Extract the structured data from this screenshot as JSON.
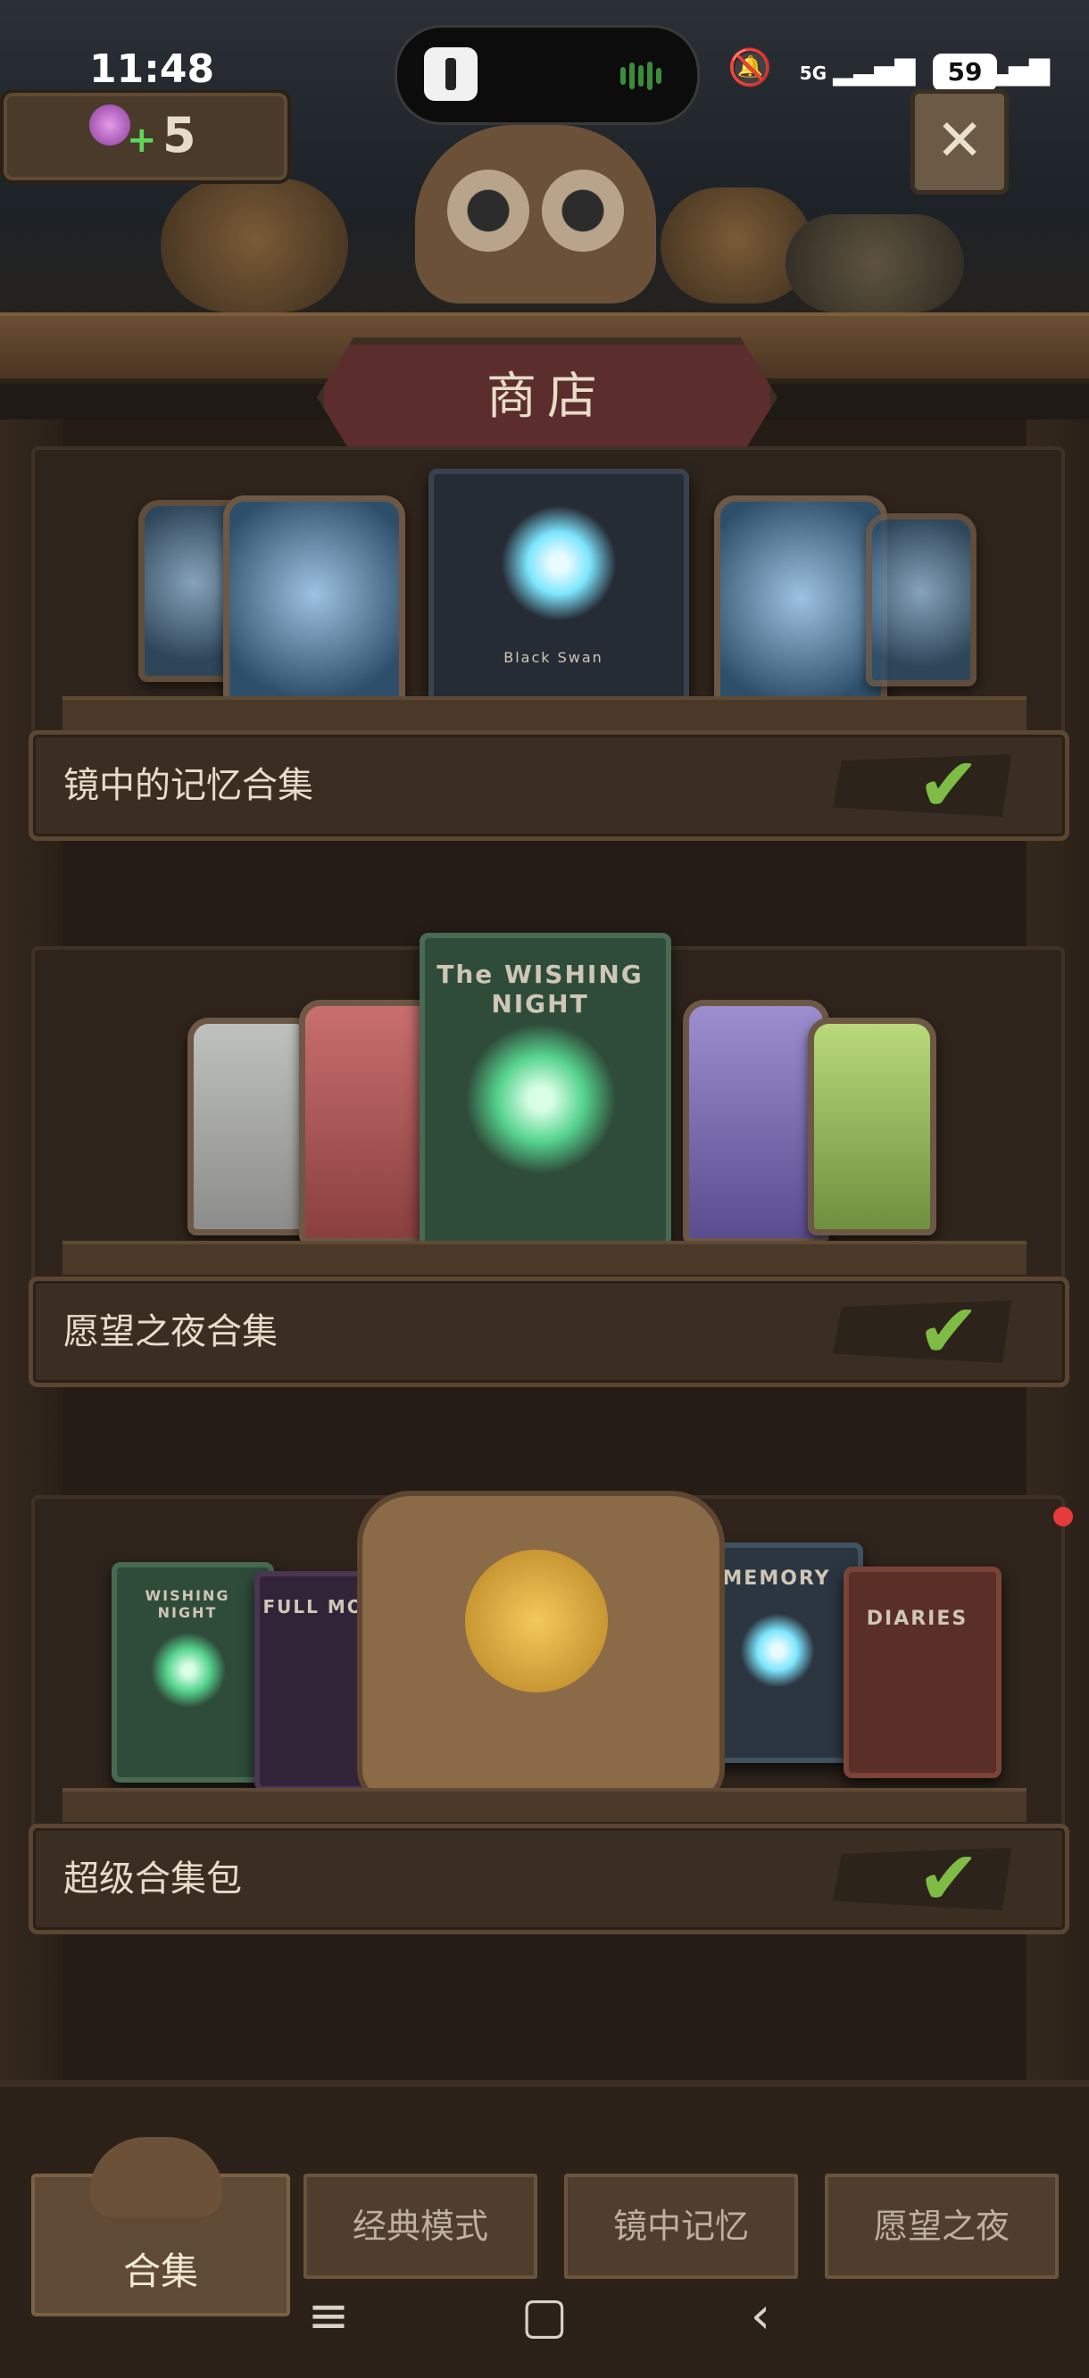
{
  "status_bar": {
    "time": "11:48",
    "signal_labels": [
      "5G",
      "5G"
    ],
    "battery": "59"
  },
  "header": {
    "candy_count": "5",
    "title": "商店"
  },
  "collections": [
    {
      "label": "镜中的记忆合集",
      "owned": true,
      "book_title": "Black Swan"
    },
    {
      "label": "愿望之夜合集",
      "owned": true,
      "book_title": "The WISHING NIGHT"
    },
    {
      "label": "超级合集包",
      "owned": true,
      "book_titles": [
        "WISHING NIGHT",
        "FULL MOON",
        "MEMORY",
        "DIARIES"
      ]
    }
  ],
  "bottom_tabs": [
    {
      "label": "合集",
      "active": true
    },
    {
      "label": "经典模式",
      "active": false
    },
    {
      "label": "镜中记忆",
      "active": false
    },
    {
      "label": "愿望之夜",
      "active": false
    }
  ],
  "icons": {
    "candy": "candy-icon",
    "close": "close-icon",
    "check": "checkmark-icon",
    "nav": [
      "menu-icon",
      "home-icon",
      "back-icon"
    ]
  },
  "colors": {
    "accent_check": "#7fbc45",
    "sign_red": "#5b2d2d",
    "wood": "#4a3928"
  }
}
